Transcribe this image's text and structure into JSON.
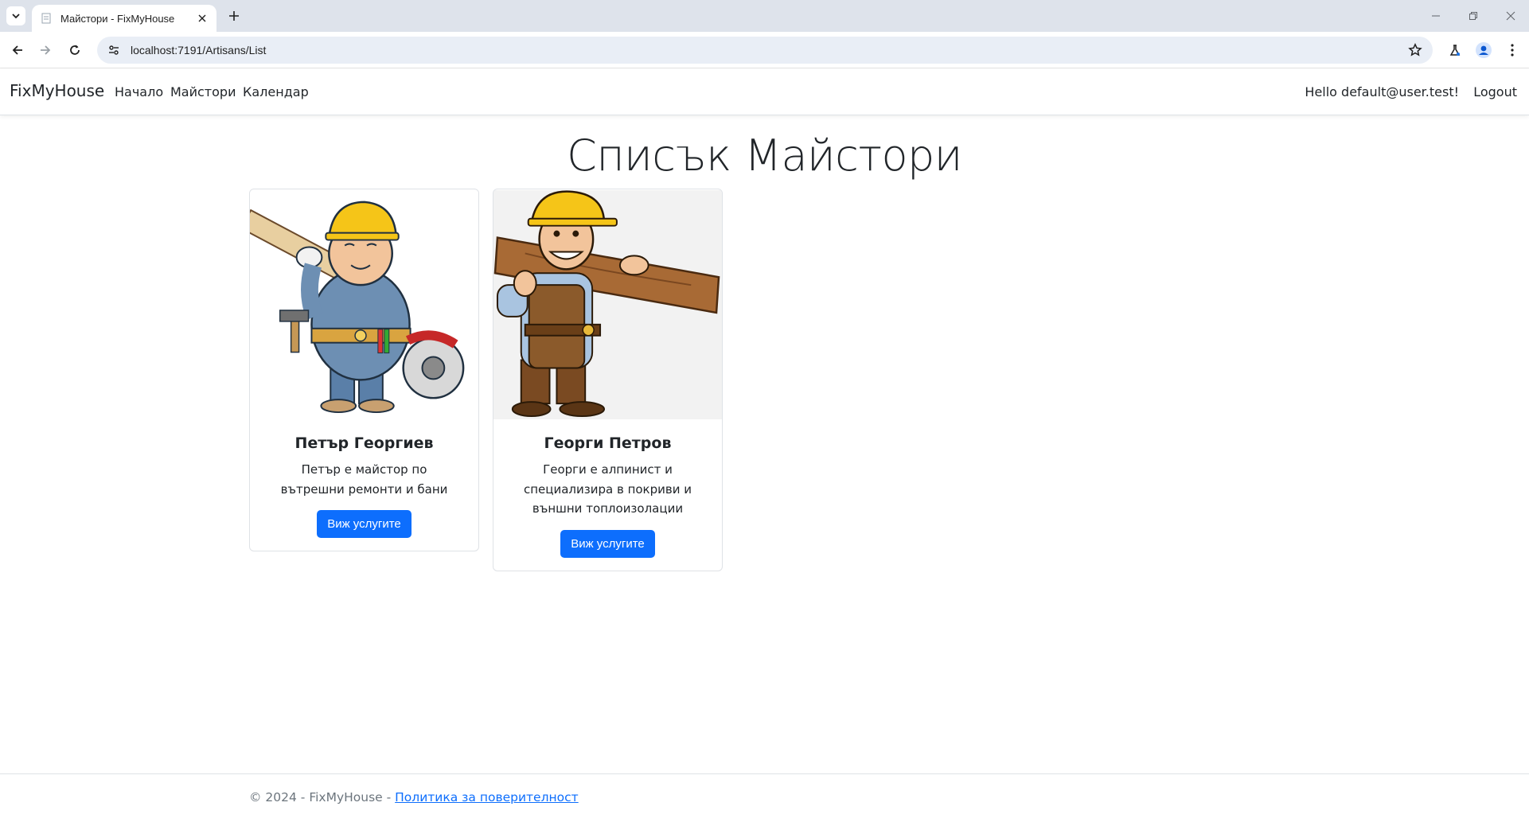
{
  "browser": {
    "tab_title": "Майстори - FixMyHouse",
    "url": "localhost:7191/Artisans/List"
  },
  "nav": {
    "brand": "FixMyHouse",
    "links": [
      "Начало",
      "Майстори",
      "Календар"
    ],
    "greeting": "Hello default@user.test!",
    "logout": "Logout"
  },
  "page": {
    "title": "Списък Майстори"
  },
  "artisans": [
    {
      "name": "Петър Георгиев",
      "description": "Петър е майстор по вътрешни ремонти и бани",
      "button": "Виж услугите"
    },
    {
      "name": "Георги Петров",
      "description": "Георги е алпинист и специализира в покриви и външни топлоизолации",
      "button": "Виж услугите"
    }
  ],
  "footer": {
    "copyright": "© 2024 - FixMyHouse - ",
    "privacy": "Политика за поверителност"
  },
  "colors": {
    "primary": "#0d6efd",
    "tabstrip": "#dee3eb",
    "omnibox": "#e9eef6"
  },
  "icons": {
    "tab_search": "chevron-down-icon",
    "favicon": "page-icon",
    "tab_close": "close-icon",
    "new_tab": "plus-icon",
    "back": "back-arrow-icon",
    "forward": "forward-arrow-icon",
    "reload": "reload-icon",
    "site_info": "tune-icon",
    "bookmark": "star-icon",
    "labs": "flask-icon",
    "profile": "profile-icon",
    "menu": "kebab-menu-icon"
  }
}
